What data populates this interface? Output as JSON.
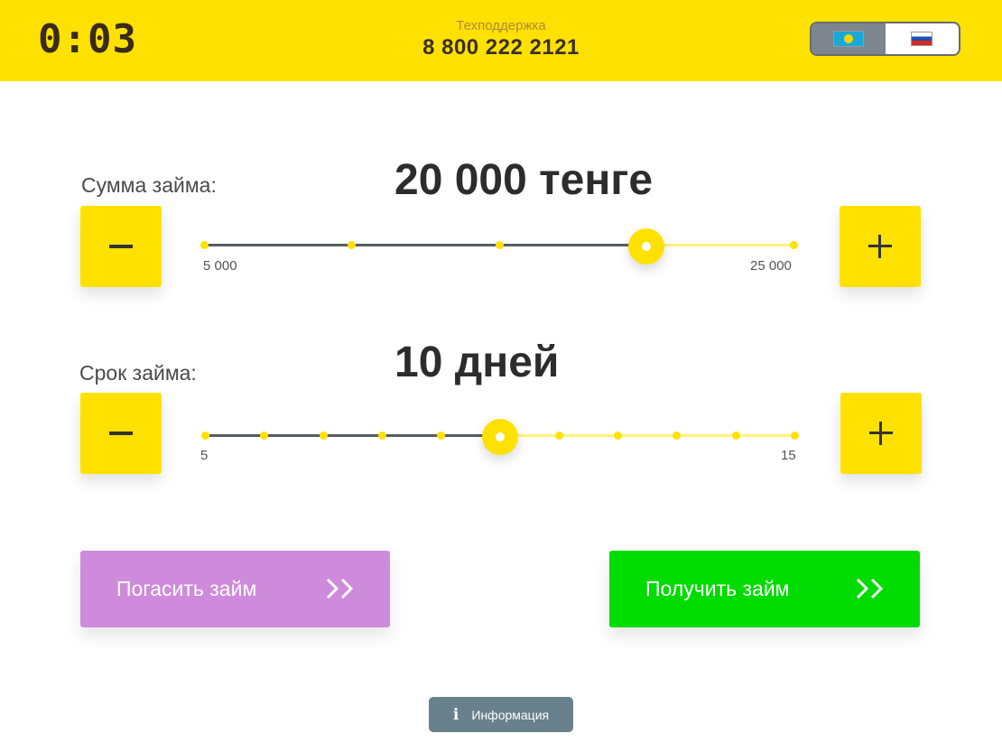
{
  "header": {
    "timer": "0:03",
    "support_label": "Техподдержка",
    "support_phone": "8 800 222 2121",
    "languages": [
      {
        "code": "kz",
        "icon": "flag-kazakhstan-icon",
        "active": true
      },
      {
        "code": "ru",
        "icon": "flag-russia-icon",
        "active": false
      }
    ]
  },
  "amount": {
    "label": "Сумма займа:",
    "value": "20 000 тенге",
    "min_label": "5 000",
    "max_label": "25 000",
    "min": 5000,
    "max": 25000,
    "current": 20000,
    "tick_count": 5
  },
  "term": {
    "label": "Срок займа:",
    "value": "10 дней",
    "min_label": "5",
    "max_label": "15",
    "min": 5,
    "max": 15,
    "current": 10,
    "tick_count": 11
  },
  "buttons": {
    "repay": "Погасить займ",
    "get": "Получить займ",
    "info": "Информация"
  },
  "colors": {
    "brand_yellow": "#ffe100",
    "repay": "#cf8bdb",
    "get": "#00dc00",
    "info": "#69808d"
  }
}
